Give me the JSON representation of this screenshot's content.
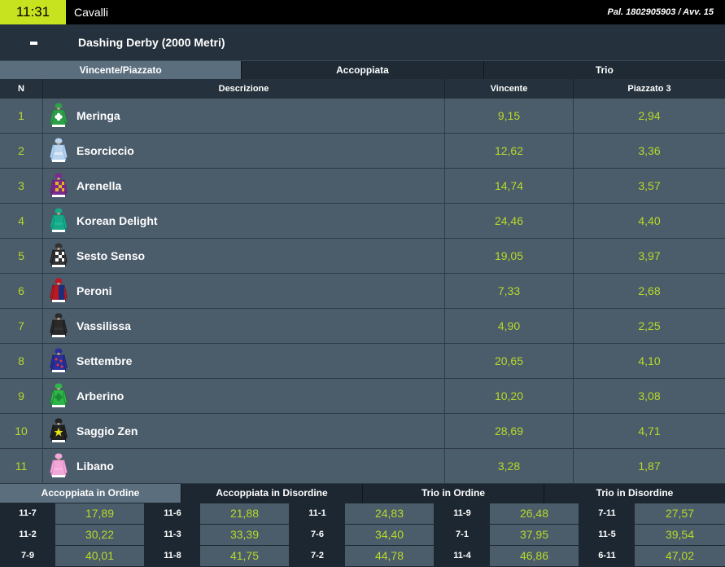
{
  "header": {
    "time": "11:31",
    "sport": "Cavalli",
    "pal_info": "Pal. 1802905903 / Avv. 15"
  },
  "race": {
    "collapse_symbol": "-",
    "title": "Dashing Derby (2000 Metri)"
  },
  "market_tabs": [
    "Vincente/Piazzato",
    "Accoppiata",
    "Trio"
  ],
  "columns": {
    "n": "N",
    "descrizione": "Descrizione",
    "vincente": "Vincente",
    "piazzato": "Piazzato 3"
  },
  "runners": [
    {
      "n": "1",
      "name": "Meringa",
      "vincente": "9,15",
      "piazzato": "2,94",
      "silk": "green-white-clover"
    },
    {
      "n": "2",
      "name": "Esorciccio",
      "vincente": "12,62",
      "piazzato": "3,36",
      "silk": "light-blue-white"
    },
    {
      "n": "3",
      "name": "Arenella",
      "vincente": "14,74",
      "piazzato": "3,57",
      "silk": "purple-yellow-check"
    },
    {
      "n": "4",
      "name": "Korean Delight",
      "vincente": "24,46",
      "piazzato": "4,40",
      "silk": "teal"
    },
    {
      "n": "5",
      "name": "Sesto Senso",
      "vincente": "19,05",
      "piazzato": "3,97",
      "silk": "black-white-check"
    },
    {
      "n": "6",
      "name": "Peroni",
      "vincente": "7,33",
      "piazzato": "2,68",
      "silk": "red-navy"
    },
    {
      "n": "7",
      "name": "Vassilissa",
      "vincente": "4,90",
      "piazzato": "2,25",
      "silk": "black"
    },
    {
      "n": "8",
      "name": "Settembre",
      "vincente": "20,65",
      "piazzato": "4,10",
      "silk": "navy-red-stars"
    },
    {
      "n": "9",
      "name": "Arberino",
      "vincente": "10,20",
      "piazzato": "3,08",
      "silk": "green-clover"
    },
    {
      "n": "10",
      "name": "Saggio Zen",
      "vincente": "28,69",
      "piazzato": "4,71",
      "silk": "black-yellow-star"
    },
    {
      "n": "11",
      "name": "Libano",
      "vincente": "3,28",
      "piazzato": "1,87",
      "silk": "pink"
    }
  ],
  "bottom_tabs": [
    "Accoppiata in Ordine",
    "Accoppiata in Disordine",
    "Trio in Ordine",
    "Trio in Disordine"
  ],
  "combo_grid": [
    [
      {
        "combo": "11-7",
        "odd": "17,89"
      },
      {
        "combo": "11-6",
        "odd": "21,88"
      },
      {
        "combo": "11-1",
        "odd": "24,83"
      },
      {
        "combo": "11-9",
        "odd": "26,48"
      },
      {
        "combo": "7-11",
        "odd": "27,57"
      }
    ],
    [
      {
        "combo": "11-2",
        "odd": "30,22"
      },
      {
        "combo": "11-3",
        "odd": "33,39"
      },
      {
        "combo": "7-6",
        "odd": "34,40"
      },
      {
        "combo": "7-1",
        "odd": "37,95"
      },
      {
        "combo": "11-5",
        "odd": "39,54"
      }
    ],
    [
      {
        "combo": "7-9",
        "odd": "40,01"
      },
      {
        "combo": "11-8",
        "odd": "41,75"
      },
      {
        "combo": "7-2",
        "odd": "44,78"
      },
      {
        "combo": "11-4",
        "odd": "46,86"
      },
      {
        "combo": "6-11",
        "odd": "47,02"
      }
    ]
  ],
  "colors": {
    "accent": "#c7e21f",
    "odds": "#b8da28",
    "row_bg": "#4b5c6b",
    "page_bg": "#1c2833"
  }
}
